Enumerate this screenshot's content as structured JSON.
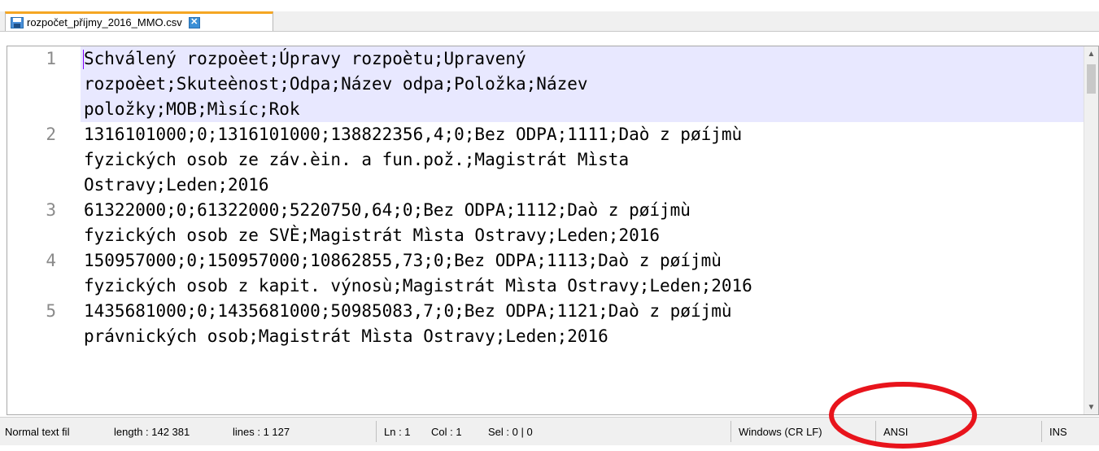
{
  "tab": {
    "filename": "rozpočet_příjmy_2016_MMO.csv",
    "file_icon": "save-disk-icon",
    "close_icon": "close-icon"
  },
  "editor": {
    "lines": [
      {
        "number": "1",
        "rows": [
          "Schválený rozpoèet;Úpravy rozpoètu;Upravený",
          "rozpoèet;Skuteènost;Odpa;Název odpa;Položka;Název",
          "položky;MOB;Mìsíc;Rok"
        ]
      },
      {
        "number": "2",
        "rows": [
          "1316101000;0;1316101000;138822356,4;0;Bez ODPA;1111;Daò z pøíjmù",
          "fyzických osob ze záv.èin. a fun.pož.;Magistrát Mìsta",
          "Ostravy;Leden;2016"
        ]
      },
      {
        "number": "3",
        "rows": [
          "61322000;0;61322000;5220750,64;0;Bez ODPA;1112;Daò z pøíjmù",
          "fyzických osob ze SVÈ;Magistrát Mìsta Ostravy;Leden;2016"
        ]
      },
      {
        "number": "4",
        "rows": [
          "150957000;0;150957000;10862855,73;0;Bez ODPA;1113;Daò z pøíjmù",
          "fyzických osob z kapit. výnosù;Magistrát Mìsta Ostravy;Leden;2016"
        ]
      },
      {
        "number": "5",
        "rows": [
          "1435681000;0;1435681000;50985083,7;0;Bez ODPA;1121;Daò z pøíjmù",
          "právnických osob;Magistrát Mìsta Ostravy;Leden;2016"
        ]
      }
    ],
    "scroll_up_icon": "chevron-up-icon",
    "scroll_down_icon": "chevron-down-icon"
  },
  "status": {
    "doc_type": "Normal text fil",
    "length": "length : 142 381",
    "lines": "lines : 1 127",
    "ln": "Ln : 1",
    "col": "Col : 1",
    "sel": "Sel : 0 | 0",
    "eol": "Windows (CR LF)",
    "encoding": "ANSI",
    "ins": "INS"
  },
  "colors": {
    "current_line": "#e8e8ff",
    "annotation": "#e8141c",
    "tab_accent": "#f5a623"
  }
}
